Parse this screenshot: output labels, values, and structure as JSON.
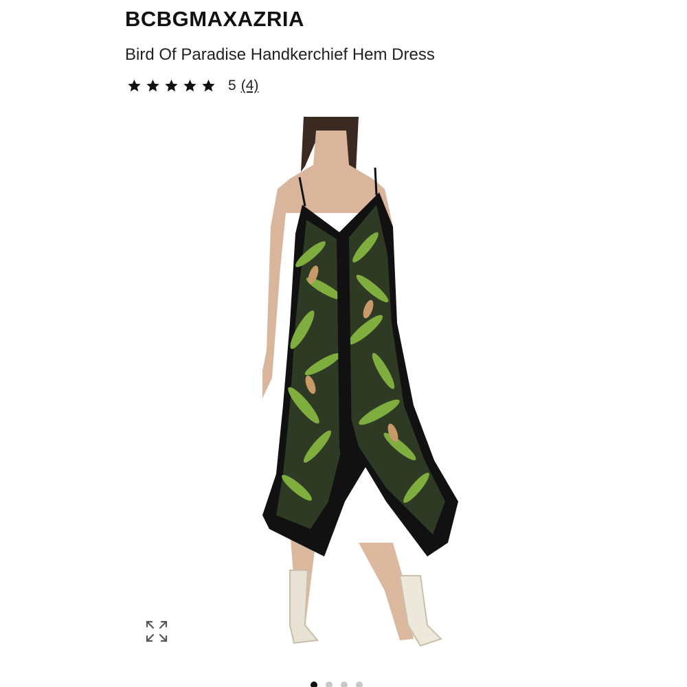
{
  "brand": "BCBGMAXAZRIA",
  "product": {
    "name": "Bird Of Paradise Handkerchief Hem Dress",
    "rating": {
      "stars": 5,
      "value": "5",
      "count": "(4)"
    }
  },
  "gallery": {
    "image_alt": "Model wearing black and green tropical print handkerchief hem dress",
    "slide_count": 4,
    "active_slide": 1,
    "expand_icon": "expand-arrows-icon"
  },
  "colors": {
    "text": "#111111",
    "dot_active": "#111111",
    "dot_inactive": "#c8c8c8",
    "dress_black": "#111111",
    "leaf_green": "#7fae3e"
  }
}
